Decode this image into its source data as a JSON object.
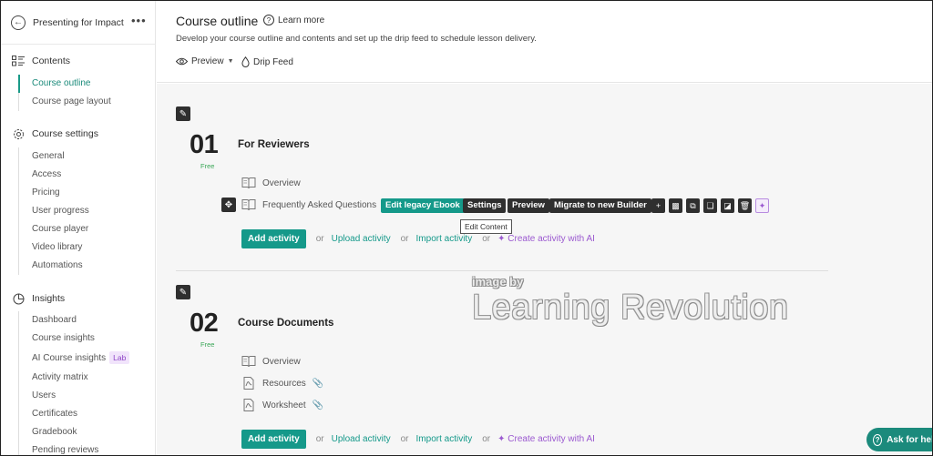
{
  "sidebar": {
    "course_name": "Presenting for Impact",
    "more": "•••",
    "sections": [
      {
        "label": "Contents",
        "icon": "contents-icon",
        "items": [
          {
            "label": "Course outline",
            "active": true
          },
          {
            "label": "Course page layout"
          }
        ]
      },
      {
        "label": "Course settings",
        "icon": "gear-icon",
        "items": [
          {
            "label": "General"
          },
          {
            "label": "Access"
          },
          {
            "label": "Pricing"
          },
          {
            "label": "User progress"
          },
          {
            "label": "Course player"
          },
          {
            "label": "Video library"
          },
          {
            "label": "Automations"
          }
        ]
      },
      {
        "label": "Insights",
        "icon": "pie-chart-icon",
        "items": [
          {
            "label": "Dashboard"
          },
          {
            "label": "Course insights"
          },
          {
            "label": "AI Course insights",
            "badge": "Lab"
          },
          {
            "label": "Activity matrix"
          },
          {
            "label": "Users"
          },
          {
            "label": "Certificates"
          },
          {
            "label": "Gradebook"
          },
          {
            "label": "Pending reviews"
          }
        ]
      }
    ]
  },
  "header": {
    "title": "Course outline",
    "learn_more": "Learn more",
    "subtitle": "Develop your course outline and contents and set up the drip feed to schedule lesson delivery.",
    "preview": "Preview",
    "drip_feed": "Drip Feed"
  },
  "sections": [
    {
      "number": "01",
      "access": "Free",
      "title": "For Reviewers",
      "activities": [
        "Overview",
        "Frequently Asked Questions"
      ]
    },
    {
      "number": "02",
      "access": "Free",
      "title": "Course Documents",
      "activities": [
        "Overview",
        "Resources",
        "Worksheet"
      ]
    }
  ],
  "toolbar": {
    "edit_legacy": "Edit legacy Ebook",
    "settings": "Settings",
    "preview": "Preview",
    "migrate": "Migrate to new Builder",
    "tooltip": "Edit Content"
  },
  "add_row": {
    "add_activity": "Add activity",
    "or": "or",
    "upload": "Upload activity",
    "import": "Import activity",
    "ai": "Create activity with AI"
  },
  "watermark": {
    "line1": "image by",
    "line2": "Learning Revolution"
  },
  "ask_help": "Ask for help",
  "colors": {
    "accent": "#15998a",
    "ai": "#9b59d0",
    "free": "#3aa757"
  }
}
